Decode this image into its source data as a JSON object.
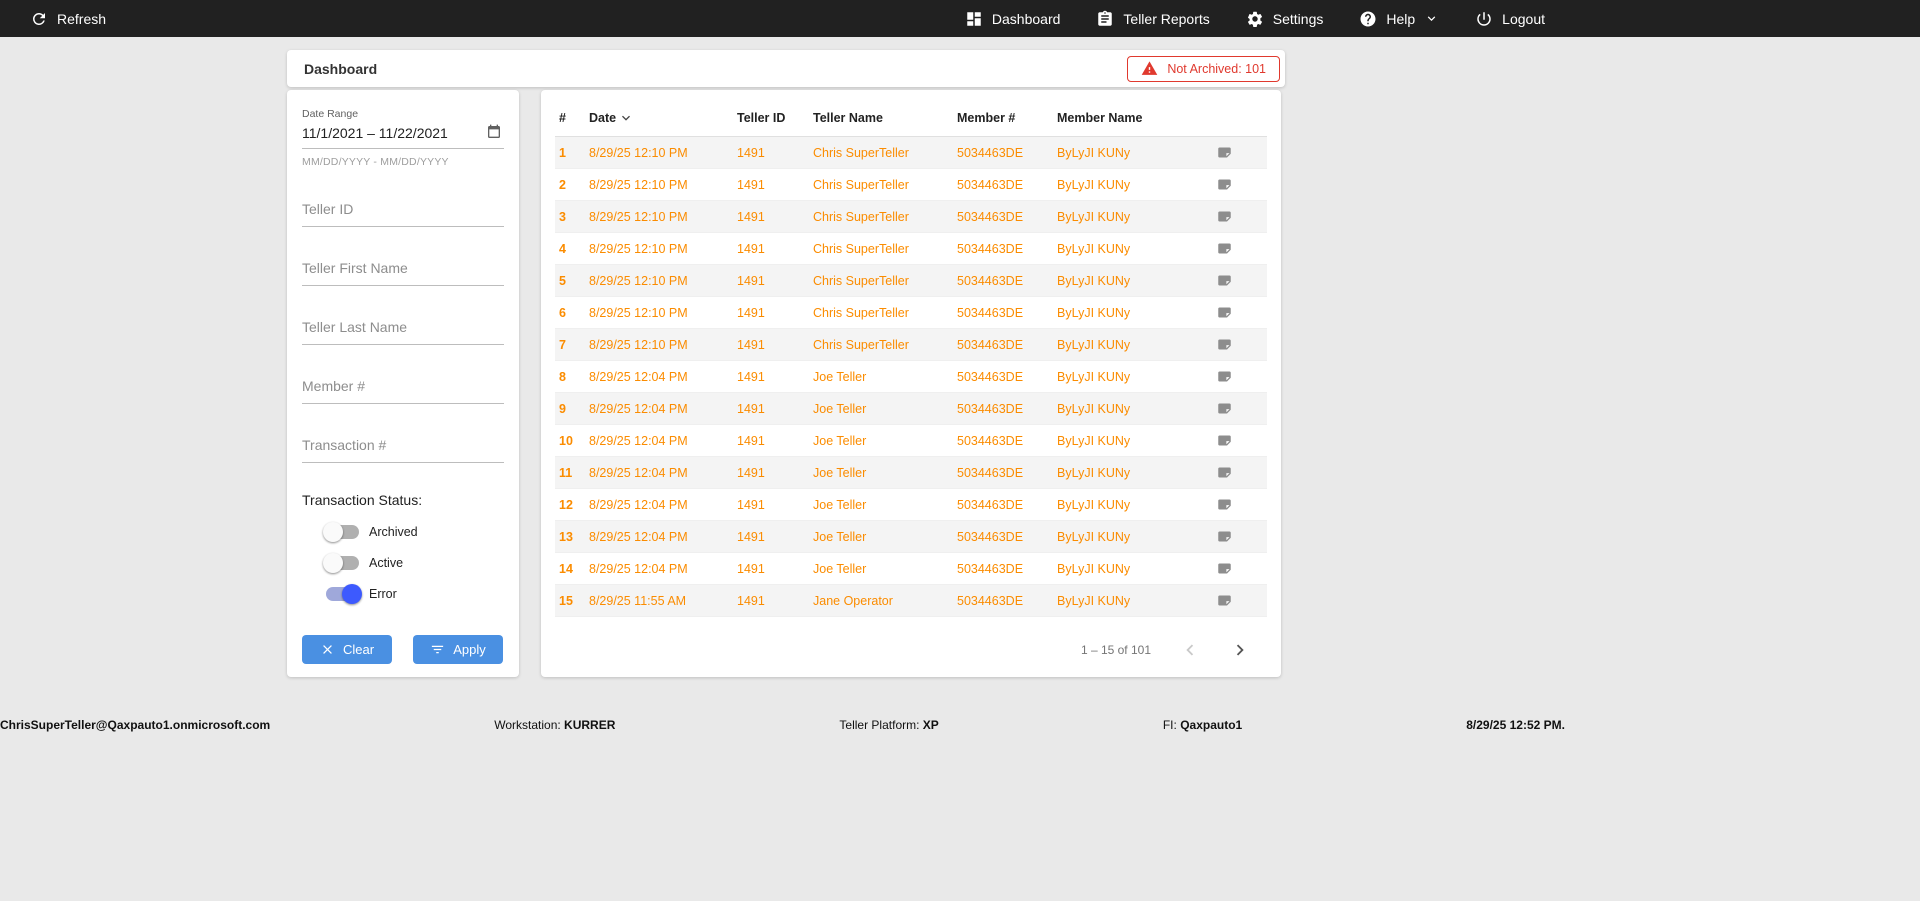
{
  "colors": {
    "topbar-bg": "#212121",
    "accent": "#4a90e2",
    "orange": "#fb8c00",
    "red": "#e0392e",
    "toggle-on-track": "#9fa8da",
    "toggle-on-thumb": "#3d5afe"
  },
  "topbar": {
    "refresh_label": "Refresh",
    "refresh_icon": "refresh-icon",
    "nav": [
      {
        "label": "Dashboard",
        "icon": "dashboard-icon"
      },
      {
        "label": "Teller Reports",
        "icon": "clipboard-icon"
      },
      {
        "label": "Settings",
        "icon": "gear-icon"
      },
      {
        "label": "Help",
        "icon": "help-icon",
        "has_dropdown": true
      },
      {
        "label": "Logout",
        "icon": "power-icon"
      }
    ]
  },
  "header": {
    "title": "Dashboard",
    "badge": {
      "label": "Not Archived: 101",
      "icon": "warning-icon"
    }
  },
  "filters": {
    "date_range": {
      "label": "Date Range",
      "value": "11/1/2021 – 11/22/2021",
      "hint": "MM/DD/YYYY - MM/DD/YYYY",
      "icon": "calendar-icon"
    },
    "fields": [
      {
        "placeholder": "Teller ID"
      },
      {
        "placeholder": "Teller First Name"
      },
      {
        "placeholder": "Teller Last Name"
      },
      {
        "placeholder": "Member #"
      },
      {
        "placeholder": "Transaction #"
      }
    ],
    "status": {
      "label": "Transaction Status:",
      "toggles": [
        {
          "label": "Archived",
          "on": false
        },
        {
          "label": "Active",
          "on": false
        },
        {
          "label": "Error",
          "on": true
        }
      ]
    },
    "clear_label": "Clear",
    "apply_label": "Apply"
  },
  "table": {
    "columns": [
      "#",
      "Date",
      "Teller ID",
      "Teller Name",
      "Member #",
      "Member Name"
    ],
    "sort_column": "Date",
    "rows": [
      {
        "num": "1",
        "date": "8/29/25 12:10 PM",
        "teller_id": "1491",
        "teller_name": "Chris SuperTeller",
        "member": "5034463DE",
        "member_name": "ByLyJI KUNy"
      },
      {
        "num": "2",
        "date": "8/29/25 12:10 PM",
        "teller_id": "1491",
        "teller_name": "Chris SuperTeller",
        "member": "5034463DE",
        "member_name": "ByLyJI KUNy"
      },
      {
        "num": "3",
        "date": "8/29/25 12:10 PM",
        "teller_id": "1491",
        "teller_name": "Chris SuperTeller",
        "member": "5034463DE",
        "member_name": "ByLyJI KUNy"
      },
      {
        "num": "4",
        "date": "8/29/25 12:10 PM",
        "teller_id": "1491",
        "teller_name": "Chris SuperTeller",
        "member": "5034463DE",
        "member_name": "ByLyJI KUNy"
      },
      {
        "num": "5",
        "date": "8/29/25 12:10 PM",
        "teller_id": "1491",
        "teller_name": "Chris SuperTeller",
        "member": "5034463DE",
        "member_name": "ByLyJI KUNy"
      },
      {
        "num": "6",
        "date": "8/29/25 12:10 PM",
        "teller_id": "1491",
        "teller_name": "Chris SuperTeller",
        "member": "5034463DE",
        "member_name": "ByLyJI KUNy"
      },
      {
        "num": "7",
        "date": "8/29/25 12:10 PM",
        "teller_id": "1491",
        "teller_name": "Chris SuperTeller",
        "member": "5034463DE",
        "member_name": "ByLyJI KUNy"
      },
      {
        "num": "8",
        "date": "8/29/25 12:04 PM",
        "teller_id": "1491",
        "teller_name": "Joe Teller",
        "member": "5034463DE",
        "member_name": "ByLyJI KUNy"
      },
      {
        "num": "9",
        "date": "8/29/25 12:04 PM",
        "teller_id": "1491",
        "teller_name": "Joe Teller",
        "member": "5034463DE",
        "member_name": "ByLyJI KUNy"
      },
      {
        "num": "10",
        "date": "8/29/25 12:04 PM",
        "teller_id": "1491",
        "teller_name": "Joe Teller",
        "member": "5034463DE",
        "member_name": "ByLyJI KUNy"
      },
      {
        "num": "11",
        "date": "8/29/25 12:04 PM",
        "teller_id": "1491",
        "teller_name": "Joe Teller",
        "member": "5034463DE",
        "member_name": "ByLyJI KUNy"
      },
      {
        "num": "12",
        "date": "8/29/25 12:04 PM",
        "teller_id": "1491",
        "teller_name": "Joe Teller",
        "member": "5034463DE",
        "member_name": "ByLyJI KUNy"
      },
      {
        "num": "13",
        "date": "8/29/25 12:04 PM",
        "teller_id": "1491",
        "teller_name": "Joe Teller",
        "member": "5034463DE",
        "member_name": "ByLyJI KUNy"
      },
      {
        "num": "14",
        "date": "8/29/25 12:04 PM",
        "teller_id": "1491",
        "teller_name": "Joe Teller",
        "member": "5034463DE",
        "member_name": "ByLyJI KUNy"
      },
      {
        "num": "15",
        "date": "8/29/25 11:55 AM",
        "teller_id": "1491",
        "teller_name": "Jane Operator",
        "member": "5034463DE",
        "member_name": "ByLyJI KUNy"
      }
    ],
    "row_note_icon": "note-icon",
    "pagination": {
      "range": "1 – 15 of 101"
    }
  },
  "statusbar": {
    "user": "ChrisSuperTeller@Qaxpauto1.onmicrosoft.com",
    "workstation": {
      "label": "Workstation:",
      "value": "KURRER"
    },
    "platform": {
      "label": "Teller Platform:",
      "value": "XP"
    },
    "fi": {
      "label": "FI:",
      "value": "Qaxpauto1"
    },
    "timestamp": "8/29/25 12:52 PM."
  }
}
